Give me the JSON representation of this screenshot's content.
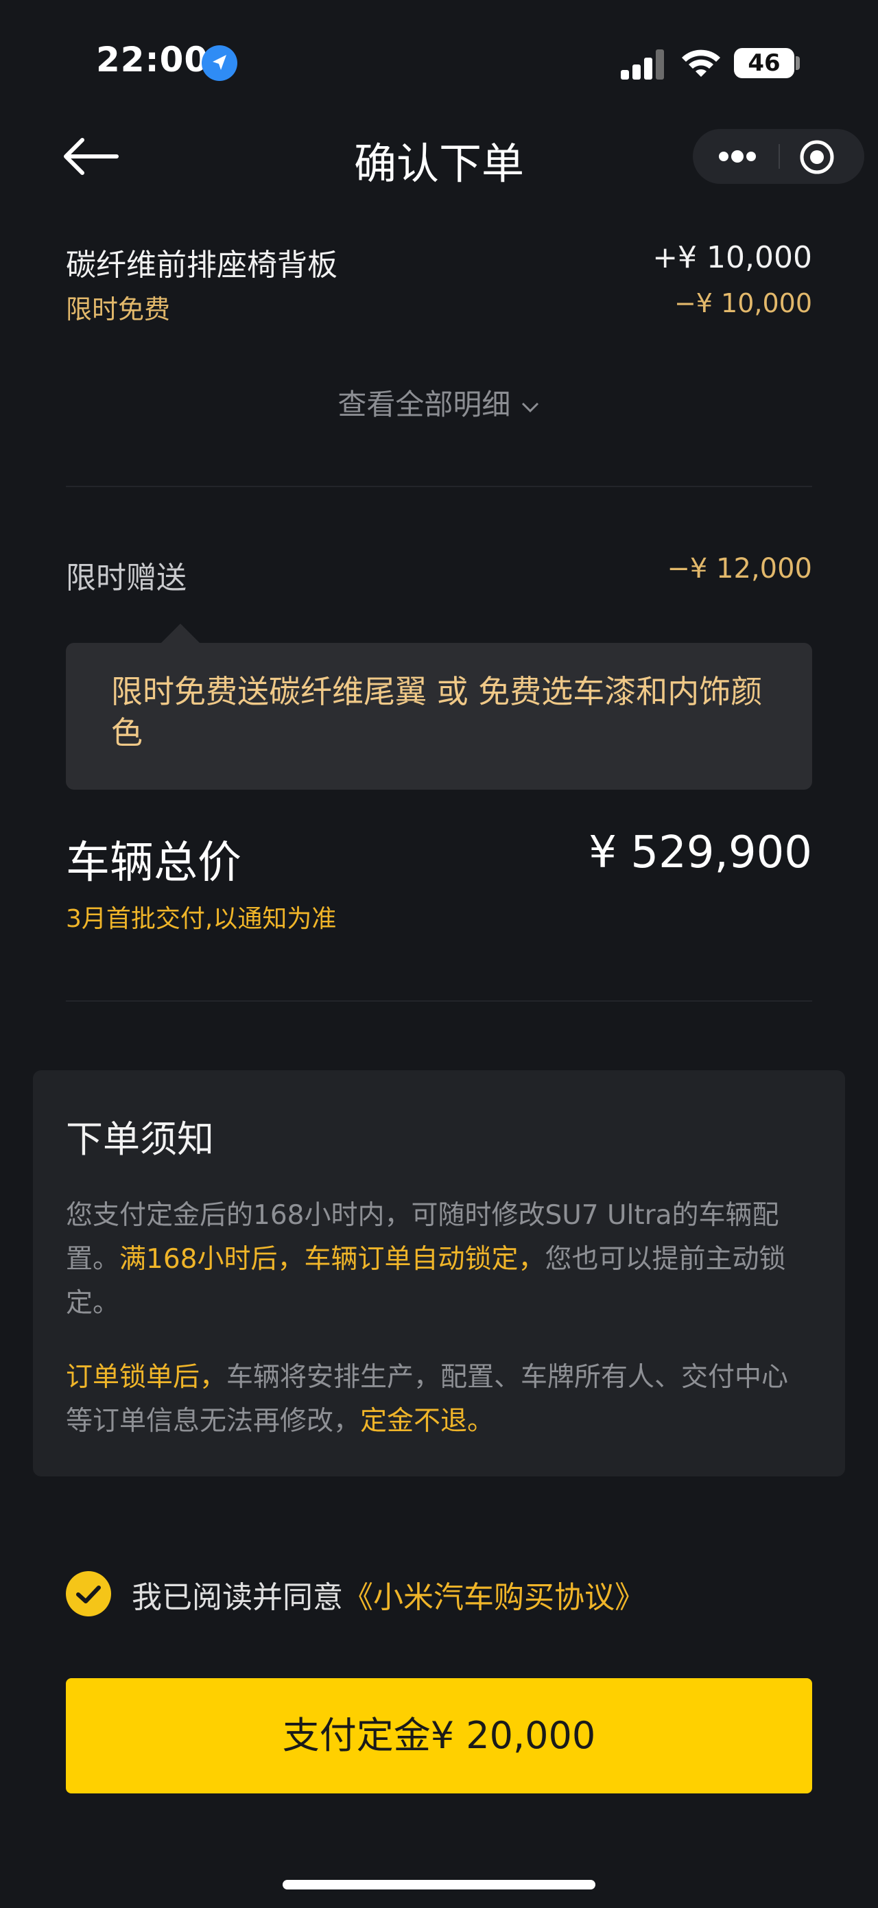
{
  "status_bar": {
    "time": "22:00",
    "battery": "46"
  },
  "nav": {
    "title": "确认下单"
  },
  "price_rows": [
    {
      "name": "碳纤维前排座椅背板",
      "price": "+¥ 10,000",
      "sub_label": "限时免费",
      "discount": "−¥ 10,000"
    }
  ],
  "view_all_label": "查看全部明细",
  "gift": {
    "label": "限时赠送",
    "price": "−¥ 12,000",
    "tooltip": "限时免费送碳纤维尾翼 或 免费选车漆和内饰颜色"
  },
  "total": {
    "label": "车辆总价",
    "price": "¥ 529,900",
    "delivery_note": "3月首批交付,以通知为准"
  },
  "notice": {
    "title": "下单须知",
    "para1_a": "您支付定金后的168小时内，可随时修改SU7 Ultra的车辆配置。",
    "para1_b": "满168小时后，车辆订单自动锁定，",
    "para1_c": "您也可以提前主动锁定。",
    "para2_a": "订单锁单后，",
    "para2_b": "车辆将安排生产，配置、车牌所有人、交付中心等订单信息无法再修改，",
    "para2_c": "定金不退。"
  },
  "agreement": {
    "text": "我已阅读并同意",
    "link": "《小米汽车购买协议》",
    "checked": true
  },
  "pay_button": {
    "label": "支付定金¥ 20,000"
  },
  "colors": {
    "background": "#15171b",
    "accent_yellow": "#ffd000",
    "highlight": "#f0b529",
    "discount": "#e2b86b"
  },
  "icons": [
    "location-arrow-icon",
    "signal-icon",
    "wifi-icon",
    "battery-icon",
    "back-arrow-icon",
    "more-dots-icon",
    "target-icon",
    "chevron-down-icon",
    "checkmark-icon"
  ]
}
